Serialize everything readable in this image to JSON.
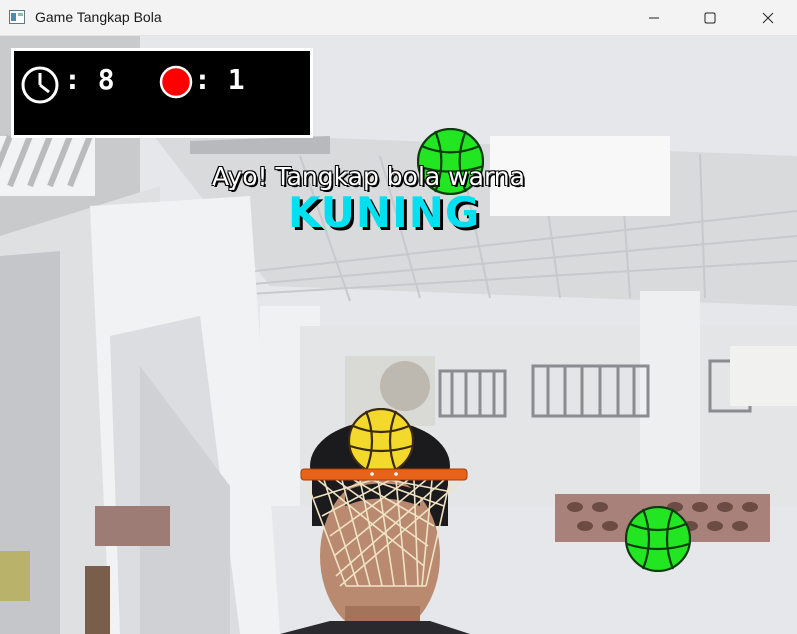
{
  "window": {
    "title": "Game Tangkap Bola",
    "minimize_icon": "minimize-icon",
    "maximize_icon": "maximize-icon",
    "close_icon": "close-icon"
  },
  "hud": {
    "timer_icon": "clock-icon",
    "timer_value": ": 8",
    "score_icon": "red-ball-icon",
    "score_value": ": 1"
  },
  "instruction": {
    "prompt": "Ayo! Tangkap bola warna",
    "target_color": "KUNING",
    "target_color_hex": "#00e0f0"
  },
  "balls": [
    {
      "color": "green",
      "hex": "#22e622"
    },
    {
      "color": "yellow",
      "hex": "#f2d92b"
    },
    {
      "color": "green",
      "hex": "#22e622"
    }
  ],
  "hoop": {
    "rim_color": "#e8631a",
    "net_color": "#efe3c4"
  }
}
